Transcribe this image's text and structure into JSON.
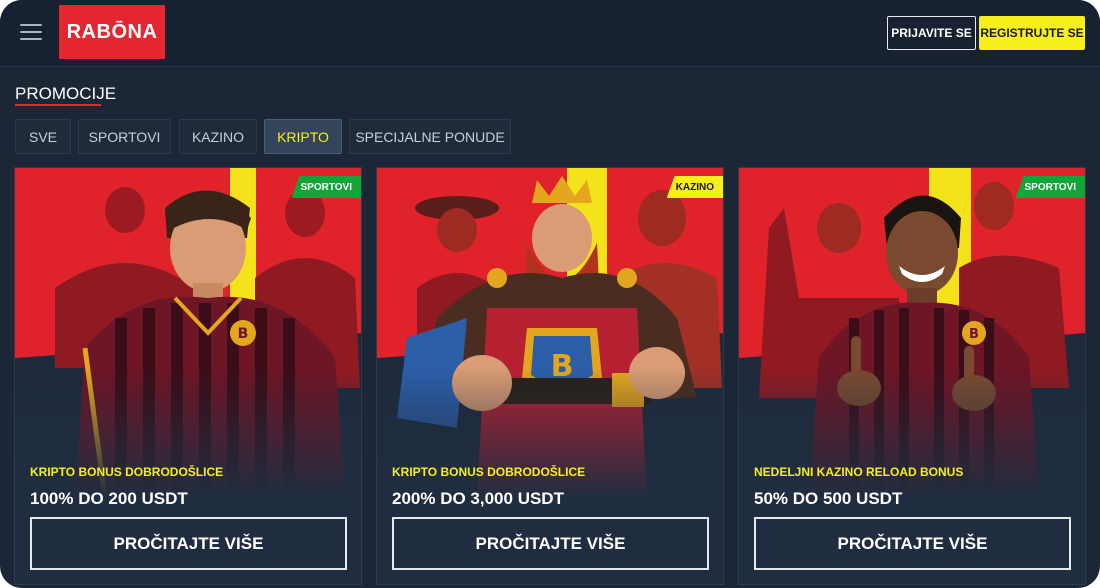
{
  "header": {
    "logo_text": "RABŌNA",
    "login_label": "PRIJAVITE SE",
    "register_label": "REGISTRUJTE SE"
  },
  "page": {
    "title": "PROMOCIJE"
  },
  "tabs": [
    {
      "label": "SVE",
      "active": false
    },
    {
      "label": "SPORTOVI",
      "active": false
    },
    {
      "label": "KAZINO",
      "active": false
    },
    {
      "label": "KRIPTO",
      "active": true
    },
    {
      "label": "SPECIJALNE PONUDE",
      "active": false
    }
  ],
  "cards": [
    {
      "badge": "SPORTOVI",
      "badge_color": "#13a538",
      "subtitle": "KRIPTO BONUS DOBRODOŠLICE",
      "title": "100% DO 200 USDT",
      "button": "PROČITAJTE VIŠE",
      "image": "footballer-player-illustration"
    },
    {
      "badge": "KAZINO",
      "badge_color": "#f6ef1b",
      "subtitle": "KRIPTO BONUS DOBRODOŠLICE",
      "title": "200% DO 3,000 USDT",
      "button": "PROČITAJTE VIŠE",
      "image": "crypto-king-illustration"
    },
    {
      "badge": "SPORTOVI",
      "badge_color": "#13a538",
      "subtitle": "NEDELJNI KAZINO RELOAD BONUS",
      "title": "50% DO 500 USDT",
      "button": "PROČITAJTE VIŠE",
      "image": "smiling-footballer-illustration"
    }
  ],
  "colors": {
    "background": "#1b2636",
    "accent_red": "#e3262f",
    "accent_yellow": "#f6ef1b",
    "badge_green": "#13a538"
  }
}
